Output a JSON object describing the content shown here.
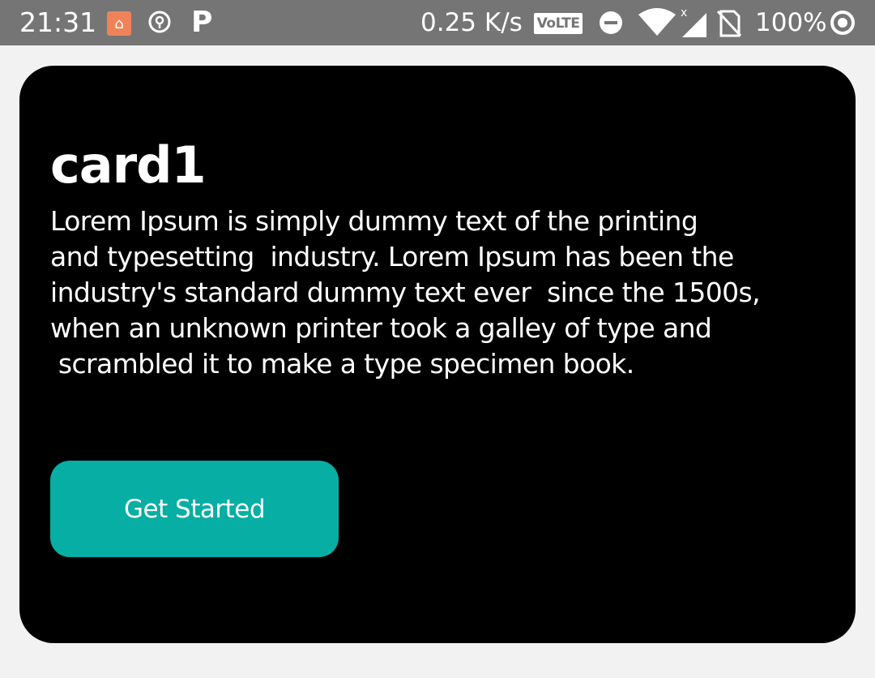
{
  "status_bar": {
    "time": "21:31",
    "net_speed": "0.25 K/s",
    "volte": "VoLTE",
    "battery": "100%",
    "icons": [
      "app-notification-icon",
      "location-icon",
      "parking-icon",
      "dnd-icon",
      "wifi-icon",
      "signal-icon",
      "no-sim-icon",
      "ring-icon"
    ]
  },
  "card": {
    "title": "card1",
    "body": "Lorem Ipsum is simply dummy text of the printing\nand typesetting  industry. Lorem Ipsum has been the\nindustry's standard dummy text ever  since the 1500s,\nwhen an unknown printer took a galley of type and\n scrambled it to make a type specimen book.",
    "button_label": "Get Started"
  },
  "colors": {
    "status_bar_bg": "#757575",
    "page_bg": "#f2f2f2",
    "card_bg": "#000000",
    "button_bg": "#06aea4"
  }
}
